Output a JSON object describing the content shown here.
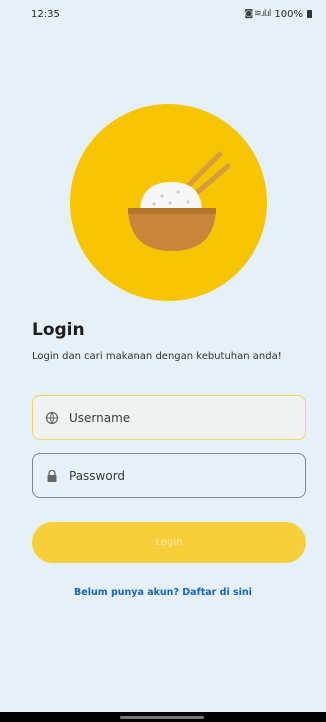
{
  "status_bar": {
    "time": "12:35",
    "signal_icons": "◙ ≋.ıl.ıl",
    "battery_text": "100%"
  },
  "hero": {
    "icon": "rice-bowl-illustration",
    "circle_color": "#f6c400",
    "bowl_color": "#c8863a",
    "rice_color": "#f7f7f7",
    "chopsticks_color": "#d99b3c"
  },
  "login": {
    "title": "Login",
    "subtitle": "Login dan cari makanan dengan kebutuhan anda!",
    "username": {
      "placeholder": "Username",
      "value": "",
      "icon": "globe-user-icon"
    },
    "password": {
      "placeholder": "Password",
      "value": "",
      "icon": "lock-icon"
    },
    "button_label": "Login",
    "register_link": "Belum punya akun? Daftar di sini"
  },
  "colors": {
    "background": "#e6f0f9",
    "accent": "#f6c400",
    "link": "#1565c0"
  }
}
